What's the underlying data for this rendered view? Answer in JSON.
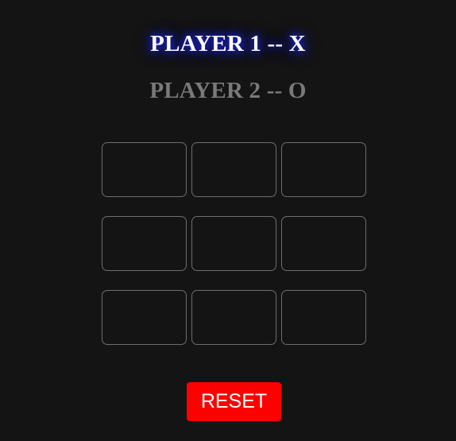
{
  "players": {
    "player1": "PLAYER 1 -- X",
    "player2": "PLAYER 2 -- O"
  },
  "board": {
    "cells": [
      "",
      "",
      "",
      "",
      "",
      "",
      "",
      "",
      ""
    ]
  },
  "controls": {
    "reset_label": "RESET"
  },
  "colors": {
    "background": "#141414",
    "active_player_glow": "#1c24d8",
    "inactive_player_text": "#7a7a7a",
    "cell_border": "#6e6e6e",
    "reset_button": "#ff0000"
  }
}
